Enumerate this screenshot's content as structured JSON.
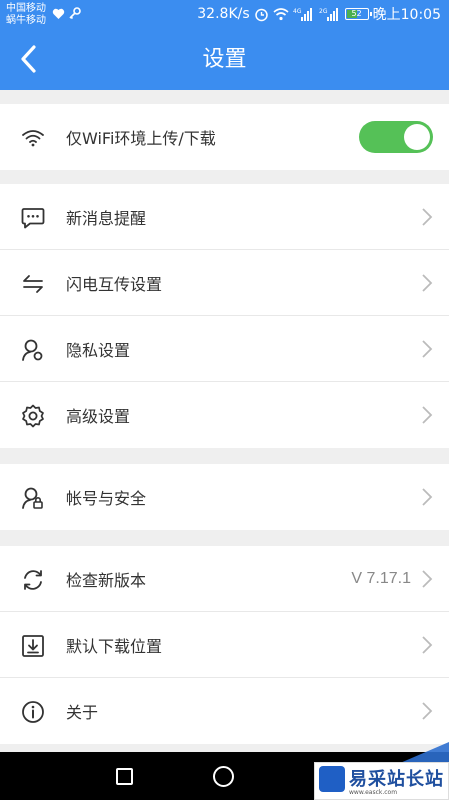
{
  "status_bar": {
    "carrier_1": "中国移动",
    "carrier_2": "蜗牛移动",
    "net_speed": "32.8K/s",
    "signal_1_label": "4G",
    "signal_2_label": "2G",
    "battery_level": "52",
    "time": "晚上10:05"
  },
  "app_bar": {
    "title": "设置",
    "back_icon": "chevron-left-icon"
  },
  "groups": [
    {
      "items": [
        {
          "icon": "wifi-icon",
          "label": "仅WiFi环境上传/下载",
          "control": "toggle",
          "toggle_on": true
        }
      ]
    },
    {
      "items": [
        {
          "icon": "message-icon",
          "label": "新消息提醒",
          "control": "chevron"
        },
        {
          "icon": "transfer-icon",
          "label": "闪电互传设置",
          "control": "chevron"
        },
        {
          "icon": "privacy-icon",
          "label": "隐私设置",
          "control": "chevron"
        },
        {
          "icon": "gear-icon",
          "label": "高级设置",
          "control": "chevron"
        }
      ]
    },
    {
      "items": [
        {
          "icon": "account-lock-icon",
          "label": "帐号与安全",
          "control": "chevron"
        }
      ]
    },
    {
      "items": [
        {
          "icon": "refresh-icon",
          "label": "检查新版本",
          "value": "V 7.17.1",
          "control": "chevron"
        },
        {
          "icon": "download-icon",
          "label": "默认下载位置",
          "control": "chevron"
        },
        {
          "icon": "info-icon",
          "label": "关于",
          "control": "chevron"
        }
      ]
    }
  ],
  "watermark": {
    "text": "易采站长站",
    "url": "www.easck.com"
  },
  "colors": {
    "primary": "#3b8df0",
    "toggle_on": "#55c157",
    "background": "#efefef"
  }
}
